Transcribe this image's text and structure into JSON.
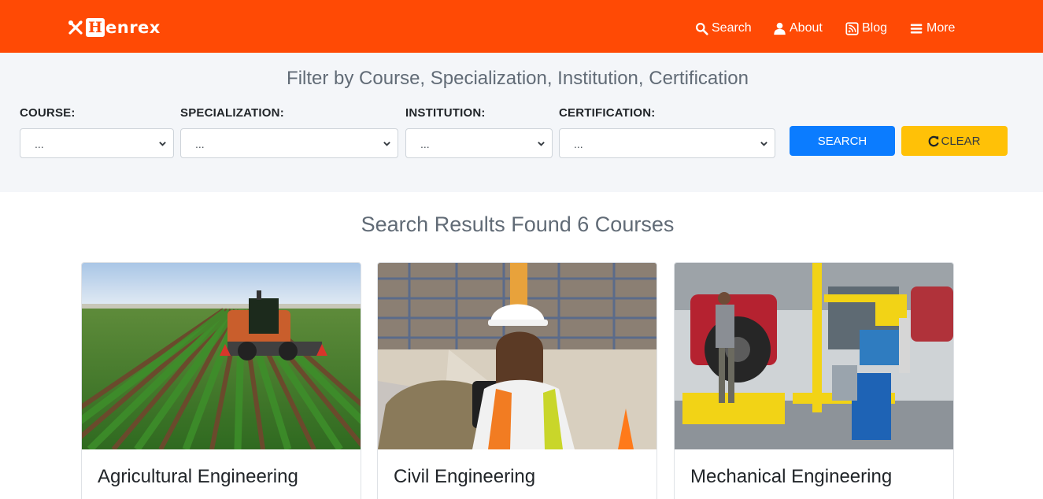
{
  "nav": {
    "brand_letter": "H",
    "brand_text": "enrex",
    "links": [
      {
        "label": "Search",
        "icon": "search-icon"
      },
      {
        "label": "About",
        "icon": "user-icon"
      },
      {
        "label": "Blog",
        "icon": "rss-icon"
      },
      {
        "label": "More",
        "icon": "menu-icon"
      }
    ]
  },
  "filter": {
    "title": "Filter by Course, Specialization, Institution, Certification",
    "fields": [
      {
        "label": "COURSE:",
        "value": "..."
      },
      {
        "label": "SPECIALIZATION:",
        "value": "..."
      },
      {
        "label": "INSTITUTION:",
        "value": "..."
      },
      {
        "label": "CERTIFICATION:",
        "value": "..."
      }
    ],
    "search_label": "SEARCH",
    "clear_label": "CLEAR"
  },
  "results": {
    "title": "Search Results Found 6 Courses",
    "cards": [
      {
        "title": "Agricultural Engineering"
      },
      {
        "title": "Civil Engineering"
      },
      {
        "title": "Mechanical Engineering"
      }
    ]
  },
  "colors": {
    "brand": "#ff4a05",
    "search_button": "#0b7cff",
    "clear_button": "#ffc107",
    "filter_background": "#f4f6f9"
  }
}
